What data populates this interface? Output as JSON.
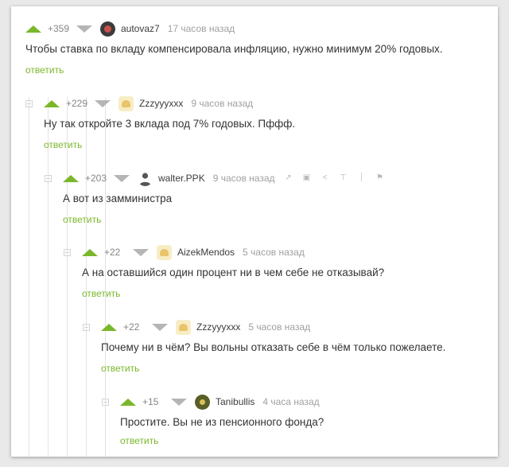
{
  "comments": [
    {
      "rating": "+359",
      "author": "autovaz7",
      "time": "17 часов назад",
      "text": "Чтобы ставка по вкладу компенсировала инфляцию, нужно минимум 20% годовых.",
      "reply_label": "ответить",
      "avatar": "dark-round-avatar"
    },
    {
      "rating": "+229",
      "author": "Zzzyyyxxx",
      "time": "9 часов назад",
      "text": "Ну так откройте 3 вклада под 7% годовых. Пффф.",
      "reply_label": "ответить",
      "avatar": "default-avatar"
    },
    {
      "rating": "+203",
      "author": "walter.PPK",
      "time": "9 часов назад",
      "text": "А вот из замминистра",
      "reply_label": "ответить",
      "avatar": "person-avatar",
      "tools": [
        "link-icon",
        "save-icon",
        "share-icon",
        "pin-icon",
        "flag-icon-1",
        "report-flag-icon"
      ]
    },
    {
      "rating": "+22",
      "author": "AizekMendos",
      "time": "5 часов назад",
      "text": "А на оставшийся один процент ни в чем себе не отказывай?",
      "reply_label": "ответить",
      "avatar": "default-avatar"
    },
    {
      "rating": "+22",
      "author": "Zzzyyyxxx",
      "time": "5 часов назад",
      "text": "Почему ни в чём? Вы вольны отказать себе в чём только пожелаете.",
      "reply_label": "ответить",
      "avatar": "default-avatar"
    },
    {
      "rating": "+15",
      "author": "Tanibullis",
      "time": "4 часа назад",
      "text": "Простите. Вы не из пенсионного фонда?",
      "reply_label": "ответить",
      "avatar": "olive-avatar"
    }
  ],
  "colors": {
    "upvote": "#7ab72a",
    "downvote": "#b5b5b5",
    "reply": "#7ab72a",
    "meta": "#a0a0a0"
  }
}
